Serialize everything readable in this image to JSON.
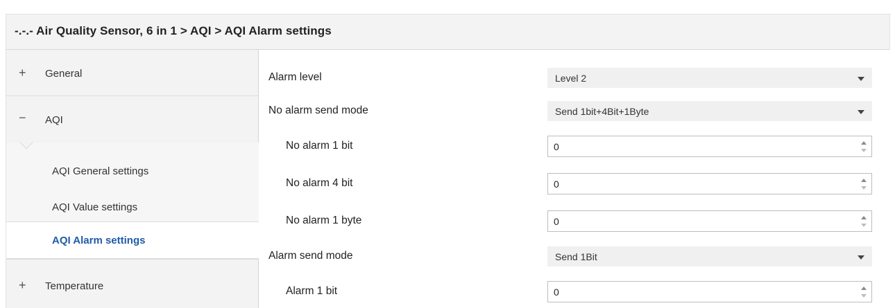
{
  "header": {
    "title": "-.-.- Air Quality Sensor, 6 in 1 > AQI > AQI Alarm settings"
  },
  "sidebar": {
    "groups": [
      {
        "sign": "+",
        "label": "General",
        "expanded": false
      },
      {
        "sign": "−",
        "label": "AQI",
        "expanded": true
      },
      {
        "sign": "+",
        "label": "Temperature",
        "expanded": false
      }
    ],
    "sub_items": [
      {
        "label": "AQI General settings",
        "active": false
      },
      {
        "label": "AQI Value settings",
        "active": false
      },
      {
        "label": "AQI Alarm settings",
        "active": true
      }
    ]
  },
  "params": [
    {
      "label": "Alarm level",
      "control": "dropdown",
      "value": "Level 2",
      "icon": "chevron-down-icon"
    },
    {
      "label": "No alarm send mode",
      "control": "dropdown",
      "value": "Send 1bit+4Bit+1Byte",
      "icon": "chevron-down-icon"
    },
    {
      "label": "No alarm 1 bit",
      "control": "spinner",
      "value": "0"
    },
    {
      "label": "No alarm 4 bit",
      "control": "spinner",
      "value": "0"
    },
    {
      "label": "No alarm 1 byte",
      "control": "spinner",
      "value": "0"
    },
    {
      "label": "Alarm send mode",
      "control": "dropdown",
      "value": "Send 1Bit",
      "icon": "chevron-down-icon"
    },
    {
      "label": "Alarm 1 bit",
      "control": "spinner",
      "value": "0"
    }
  ],
  "colors": {
    "header_bg": "#f3f3f3",
    "sidebar_bg": "#f3f3f3",
    "active_text": "#1f5aa8",
    "dropdown_bg": "#f0f0f0",
    "input_border": "#bdbdbd"
  }
}
